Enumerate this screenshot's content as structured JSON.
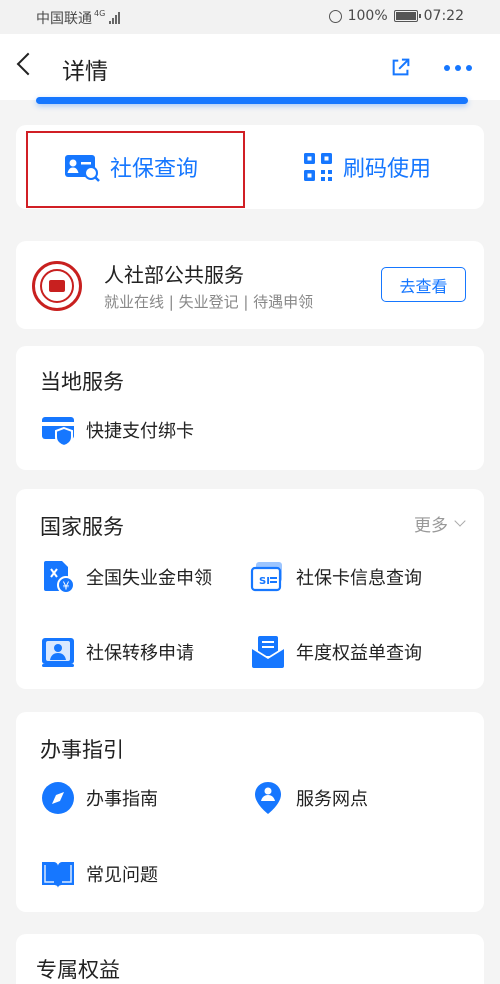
{
  "statusbar": {
    "carrier": "中国联通",
    "network": "4G",
    "battery": "100%",
    "time": "07:22"
  },
  "nav": {
    "title": "详情",
    "back_icon": "back-arrow-icon",
    "share_icon": "share-icon",
    "more_icon": "more-dots-icon"
  },
  "quick_actions": [
    {
      "label": "社保查询",
      "icon": "social-security-search-icon",
      "highlighted": true
    },
    {
      "label": "刷码使用",
      "icon": "qr-code-icon"
    }
  ],
  "service": {
    "title": "人社部公共服务",
    "subtitle": "就业在线 | 失业登记 | 待遇申领",
    "button": "去查看",
    "logo_icon": "ministry-seal-logo"
  },
  "local": {
    "title": "当地服务",
    "items": [
      {
        "label": "快捷支付绑卡",
        "icon": "card-shield-icon"
      }
    ]
  },
  "national": {
    "title": "国家服务",
    "more": "更多",
    "items": [
      {
        "label": "全国失业金申领",
        "icon": "unemployment-benefit-icon"
      },
      {
        "label": "社保卡信息查询",
        "icon": "si-card-icon"
      },
      {
        "label": "社保转移申请",
        "icon": "transfer-person-icon"
      },
      {
        "label": "年度权益单查询",
        "icon": "annual-statement-icon"
      }
    ]
  },
  "guide": {
    "title": "办事指引",
    "items": [
      {
        "label": "办事指南",
        "icon": "compass-icon"
      },
      {
        "label": "服务网点",
        "icon": "location-person-icon"
      },
      {
        "label": "常见问题",
        "icon": "book-icon"
      }
    ]
  },
  "exclusive": {
    "title": "专属权益"
  },
  "colors": {
    "accent": "#1677ff",
    "highlight": "#d11f25",
    "background": "#f4f4f4"
  }
}
